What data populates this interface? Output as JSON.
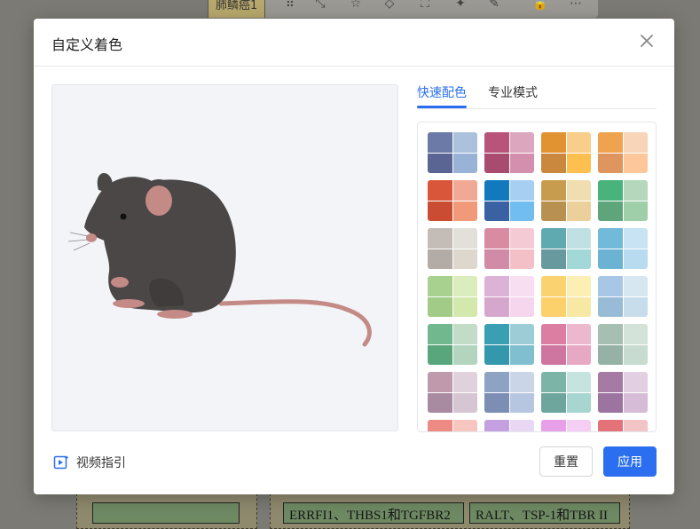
{
  "background": {
    "chip_text": "肺鳞癌1",
    "cell_1": "ERRFI1、THBS1和TGFBR2",
    "cell_2": "RALT、TSP-1和TBR II"
  },
  "dialog": {
    "title": "自定义着色",
    "tabs": [
      {
        "label": "快速配色",
        "active": true
      },
      {
        "label": "专业模式",
        "active": false
      }
    ],
    "video_guide": "视频指引",
    "reset_label": "重置",
    "apply_label": "应用"
  },
  "colors": {
    "accent": "#2b6ff0",
    "mouse_body": "#4a4746",
    "mouse_pink": "#c48a86"
  },
  "palettes": [
    [
      "#6b7aa6",
      "#acc2dc",
      "#5a6593",
      "#98b3d6"
    ],
    [
      "#b85479",
      "#dda6bf",
      "#a84b6e",
      "#d58fae"
    ],
    [
      "#e09330",
      "#f9cd8a",
      "#c9883d",
      "#fdbf4e"
    ],
    [
      "#f0a34f",
      "#f8d4b8",
      "#de955e",
      "#fdc79a"
    ],
    [
      "#d9563a",
      "#f1a995",
      "#c94c33",
      "#f09a7a"
    ],
    [
      "#1279bf",
      "#a7cff2",
      "#3a62a3",
      "#72bdf0"
    ],
    [
      "#c79c4f",
      "#f0deb0",
      "#b89151",
      "#ebd09c"
    ],
    [
      "#48b37a",
      "#b5d7bb",
      "#5ea57c",
      "#9fcfa8"
    ],
    [
      "#c4bcb6",
      "#e3dfd9",
      "#b3aba6",
      "#ddd7cd"
    ],
    [
      "#d98ba2",
      "#f4cbd4",
      "#d28ba6",
      "#f3c0c8"
    ],
    [
      "#5fa9b1",
      "#c1e0e3",
      "#68999f",
      "#a3d8d9"
    ],
    [
      "#72bad9",
      "#c8e3f3",
      "#6cb2d2",
      "#b8dbef"
    ],
    [
      "#a8d190",
      "#dcedbd",
      "#a1cb87",
      "#d3e8ad"
    ],
    [
      "#dcb2d6",
      "#f7def1",
      "#d6a7cd",
      "#f6d6ec"
    ],
    [
      "#fad26f",
      "#fbefb3",
      "#fcd06a",
      "#f7e8a4"
    ],
    [
      "#a8c6e6",
      "#d7e7f2",
      "#98bcd6",
      "#c8ddec"
    ],
    [
      "#72b88e",
      "#c3dcc8",
      "#5aa67c",
      "#b3d4be"
    ],
    [
      "#3a9fb3",
      "#9ccdd7",
      "#3498ad",
      "#7fbfcf"
    ],
    [
      "#dc7da2",
      "#ecb8cd",
      "#ce76a0",
      "#e7a8c4"
    ],
    [
      "#a5c0b2",
      "#d3e3d9",
      "#96b2a6",
      "#c7dbd0"
    ],
    [
      "#bf9aad",
      "#e0d2dc",
      "#a88aa1",
      "#d6c6d3"
    ],
    [
      "#8ea2c4",
      "#cad6e8",
      "#7c8eb4",
      "#b6c6e0"
    ],
    [
      "#7cb5a8",
      "#c6e4df",
      "#6ea59c",
      "#a6d6cf"
    ],
    [
      "#a57ba4",
      "#e2cfe1",
      "#9b74a0",
      "#d6bcd7"
    ],
    [
      "#ec8a83",
      "#f8c6c0",
      "#ea867f",
      "#f8c4bc"
    ],
    [
      "#c5a0e0",
      "#e8d8f3",
      "#b890d6",
      "#dfcbef"
    ],
    [
      "#e7a0e8",
      "#f4cff3",
      "#e197e4",
      "#f1c6f2"
    ],
    [
      "#e37279",
      "#f3c4c6",
      "#df6e76",
      "#f0b7ba"
    ]
  ]
}
